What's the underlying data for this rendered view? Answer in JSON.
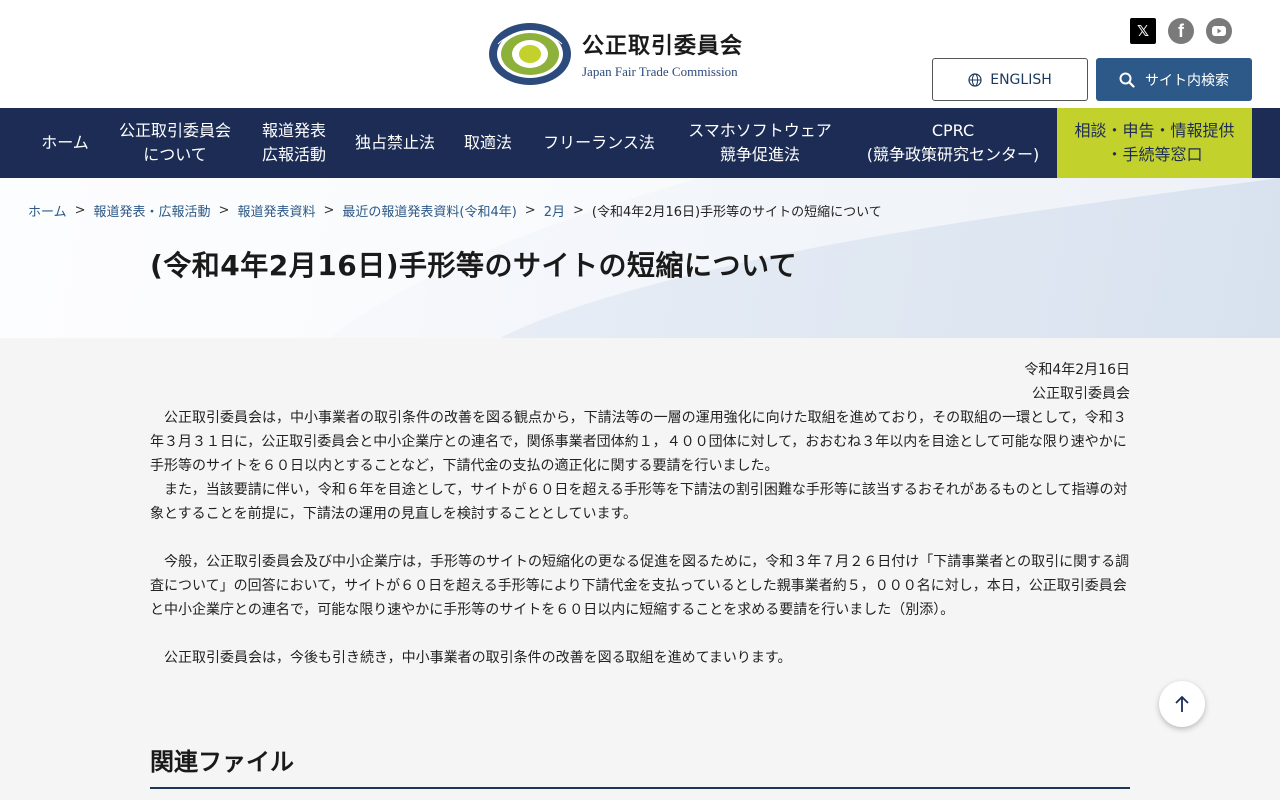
{
  "header": {
    "logo_ja": "公正取引委員会",
    "logo_en": "Japan Fair Trade Commission",
    "social": [
      "x-icon",
      "facebook-icon",
      "youtube-icon"
    ],
    "english_label": "ENGLISH",
    "search_label": "サイト内検索"
  },
  "nav": {
    "items": [
      {
        "label": "ホーム"
      },
      {
        "label": "公正取引委員会\nについて"
      },
      {
        "label": "報道発表\n広報活動"
      },
      {
        "label": "独占禁止法"
      },
      {
        "label": "取適法"
      },
      {
        "label": "フリーランス法"
      },
      {
        "label": "スマホソフトウェア\n競争促進法"
      },
      {
        "label": "CPRC\n(競争政策研究センター)"
      },
      {
        "label": "相談・申告・情報提供\n・手続等窓口"
      }
    ]
  },
  "breadcrumb": {
    "items": [
      "ホーム",
      "報道発表・広報活動",
      "報道発表資料",
      "最近の報道発表資料(令和4年)",
      "2月"
    ],
    "separator": ">",
    "current": "(令和4年2月16日)手形等のサイトの短縮について"
  },
  "page": {
    "title": "(令和4年2月16日)手形等のサイトの短縮について",
    "date": "令和4年2月16日",
    "issuer": "公正取引委員会",
    "paragraphs": [
      "　公正取引委員会は，中小事業者の取引条件の改善を図る観点から，下請法等の一層の運用強化に向けた取組を進めており，その取組の一環として，令和３年３月３１日に，公正取引委員会と中小企業庁との連名で，関係事業者団体約１，４００団体に対して，おおむね３年以内を目途として可能な限り速やかに手形等のサイトを６０日以内とすることなど，下請代金の支払の適正化に関する要請を行いました。",
      "　また，当該要請に伴い，令和６年を目途として，サイトが６０日を超える手形等を下請法の割引困難な手形等に該当するおそれがあるものとして指導の対象とすることを前提に，下請法の運用の見直しを検討することとしています。",
      "　今般，公正取引委員会及び中小企業庁は，手形等のサイトの短縮化の更なる促進を図るために，令和３年７月２６日付け「下請事業者との取引に関する調査について」の回答において，サイトが６０日を超える手形等により下請代金を支払っているとした親事業者約５，０００名に対し，本日，公正取引委員会と中小企業庁との連名で，可能な限り速やかに手形等のサイトを６０日以内に短縮することを求める要請を行いました（別添）。",
      "　公正取引委員会は，今後も引き続き，中小事業者の取引条件の改善を図る取組を進めてまいります。"
    ],
    "related_heading": "関連ファイル"
  },
  "colors": {
    "nav_bg": "#1c2c55",
    "accent_green": "#c3d12d",
    "search_bg": "#2c5987",
    "link": "#2c5987"
  }
}
